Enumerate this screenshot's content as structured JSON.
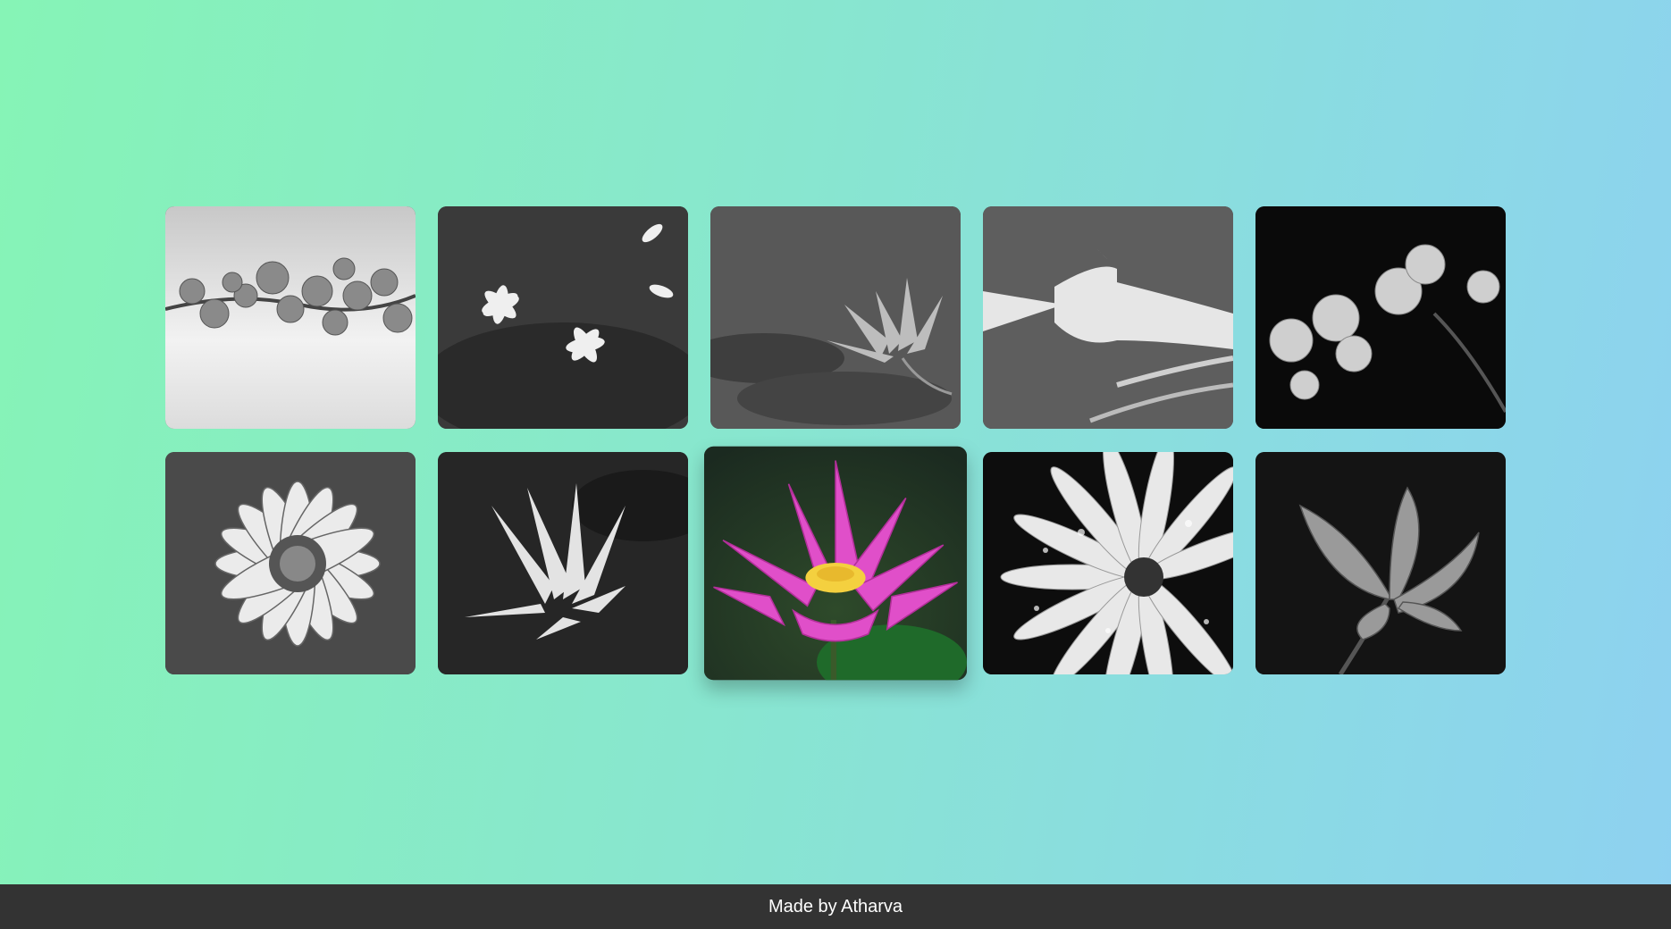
{
  "gallery": {
    "tiles": [
      {
        "subject": "cherry-blossom",
        "grayscale": true
      },
      {
        "subject": "jasmine",
        "grayscale": true
      },
      {
        "subject": "water-lily",
        "grayscale": true
      },
      {
        "subject": "lily",
        "grayscale": true
      },
      {
        "subject": "orchid",
        "grayscale": true
      },
      {
        "subject": "gazania",
        "grayscale": true
      },
      {
        "subject": "white-water-lily",
        "grayscale": true
      },
      {
        "subject": "pink-lotus",
        "grayscale": false,
        "hovered": true
      },
      {
        "subject": "daisy-with-droplets",
        "grayscale": true
      },
      {
        "subject": "crocus",
        "grayscale": true
      }
    ]
  },
  "footer": {
    "text": "Made by Atharva"
  },
  "colors": {
    "background_start": "#86f4b6",
    "background_end": "#8ed1f0",
    "footer_bg": "#333333",
    "footer_text": "#ffffff",
    "lotus_petal": "#e04fc9",
    "lotus_center": "#f4d03f"
  }
}
